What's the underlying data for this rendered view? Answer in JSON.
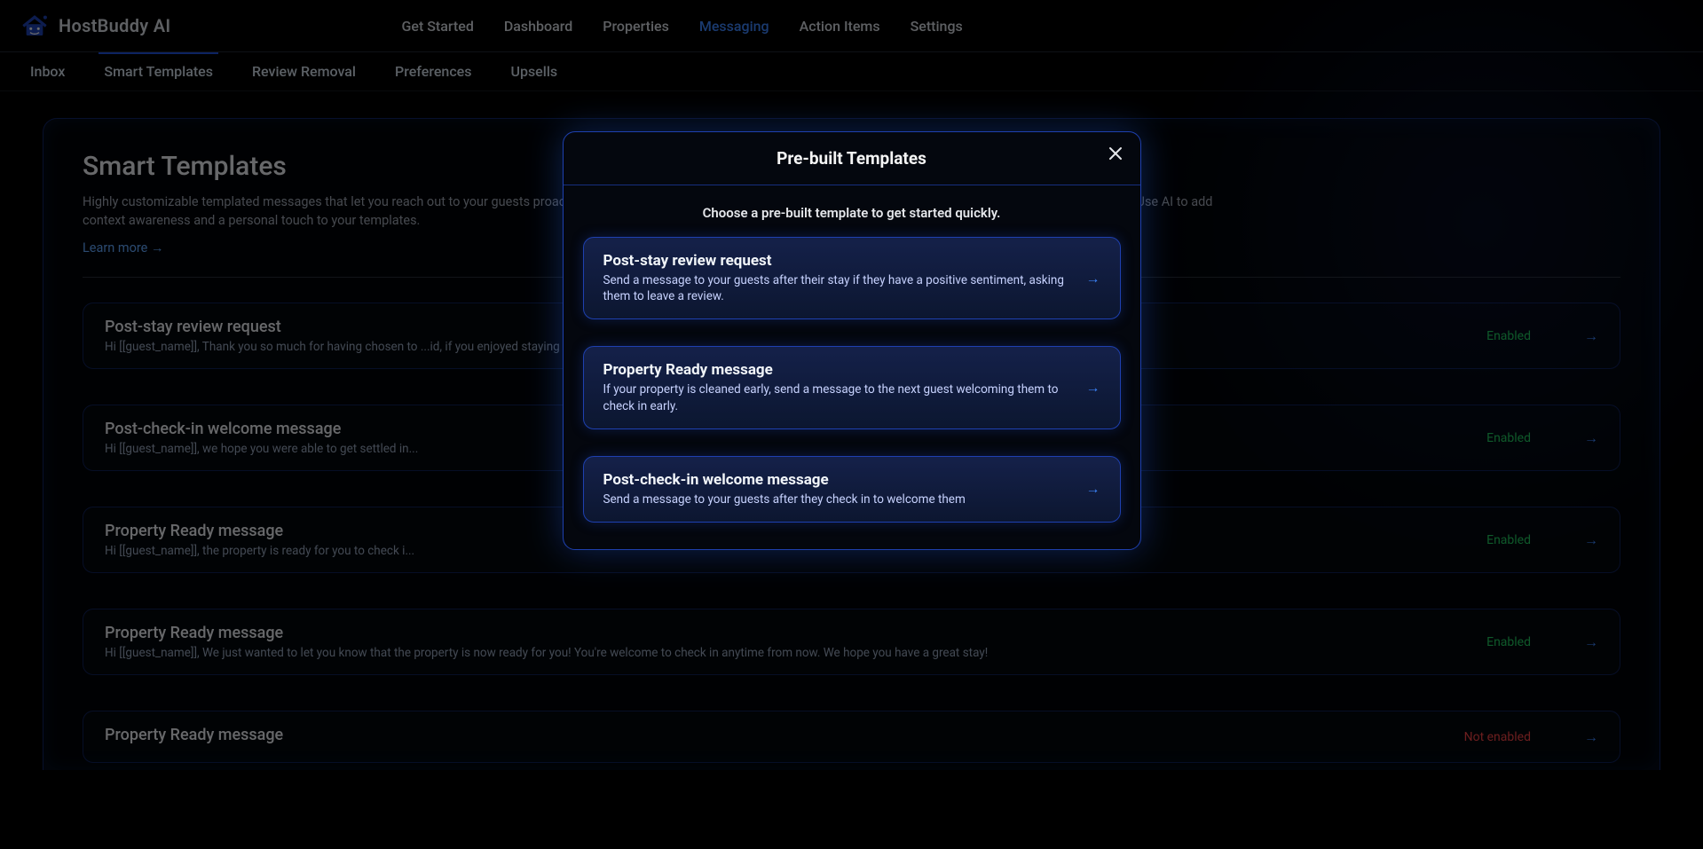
{
  "brand": {
    "name": "HostBuddy AI"
  },
  "topnav": [
    {
      "label": "Get Started",
      "active": false
    },
    {
      "label": "Dashboard",
      "active": false
    },
    {
      "label": "Properties",
      "active": false
    },
    {
      "label": "Messaging",
      "active": true
    },
    {
      "label": "Action Items",
      "active": false
    },
    {
      "label": "Settings",
      "active": false
    }
  ],
  "subnav": [
    {
      "label": "Inbox",
      "active": false
    },
    {
      "label": "Smart Templates",
      "active": true
    },
    {
      "label": "Review Removal",
      "active": false
    },
    {
      "label": "Preferences",
      "active": false
    },
    {
      "label": "Upsells",
      "active": false
    }
  ],
  "panel": {
    "title": "Smart Templates",
    "desc": "Highly customizable templated messages that let you reach out to your guests proactively. Great for welcome messages, checkout reminders, upsells, policy reminders, and much more. Use AI to add context awareness and a personal touch to your templates.",
    "link": "Learn more →"
  },
  "rows": [
    {
      "title": "Post-stay review request",
      "preview": "Hi [[guest_name]], Thank you so much for having chosen to ...id, if you enjoyed staying with us as ...",
      "status": "Enabled",
      "enabled": true
    },
    {
      "title": "Post-check-in welcome message",
      "preview": "Hi [[guest_name]], we hope you were able to get settled in...",
      "status": "Enabled",
      "enabled": true
    },
    {
      "title": "Property Ready message",
      "preview": "Hi [[guest_name]], the property is ready for you to check i...",
      "status": "Enabled",
      "enabled": true
    },
    {
      "title": "Property Ready message",
      "preview": "Hi [[guest_name]], We just wanted to let you know that the property is now ready for you! You're welcome to check in anytime from now. We hope you have a great stay!",
      "status": "Enabled",
      "enabled": true
    },
    {
      "title": "Property Ready message",
      "preview": "",
      "status": "Not enabled",
      "enabled": false
    }
  ],
  "modal": {
    "title": "Pre-built Templates",
    "subtitle": "Choose a pre-built template to get started quickly.",
    "items": [
      {
        "title": "Post-stay review request",
        "desc": "Send a message to your guests after their stay if they have a positive sentiment, asking them to leave a review."
      },
      {
        "title": "Property Ready message",
        "desc": "If your property is cleaned early, send a message to the next guest welcoming them to check in early."
      },
      {
        "title": "Post-check-in welcome message",
        "desc": "Send a message to your guests after they check in to welcome them"
      }
    ]
  }
}
